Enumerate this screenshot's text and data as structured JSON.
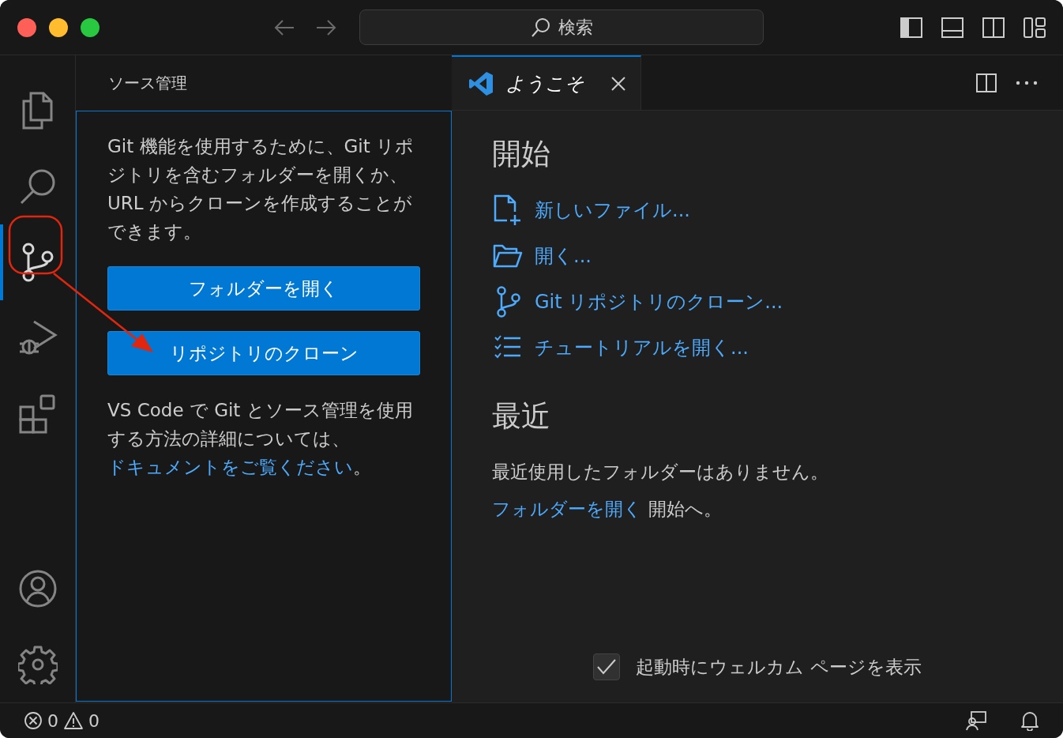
{
  "title_bar": {
    "search_label": "検索"
  },
  "activity_bar": {
    "items": [
      {
        "kind": "files",
        "selected": false
      },
      {
        "kind": "search",
        "selected": false
      },
      {
        "kind": "source-control",
        "selected": true
      },
      {
        "kind": "run-debug",
        "selected": false
      },
      {
        "kind": "extensions",
        "selected": false
      }
    ],
    "bottom_items": [
      {
        "kind": "account"
      },
      {
        "kind": "settings"
      }
    ]
  },
  "sidebar": {
    "title": "ソース管理",
    "intro": "Git 機能を使用するために、Git リポジトリを含むフォルダーを開くか、URL からクローンを作成することができます。",
    "buttons": [
      "フォルダーを開く",
      "リポジトリのクローン"
    ],
    "docs_text": "VS Code で Git とソース管理を使用する方法の詳細については、",
    "docs_link": "ドキュメントをご覧ください",
    "docs_end": "。"
  },
  "editor": {
    "tabs": [
      {
        "label": "ようこそ",
        "selected": true
      }
    ],
    "start": {
      "heading": "開始",
      "items": [
        {
          "kind": "new-file",
          "label": "新しいファイル..."
        },
        {
          "kind": "open",
          "label": "開く..."
        },
        {
          "kind": "clone",
          "label": "Git リポジトリのクローン..."
        },
        {
          "kind": "tutorial",
          "label": "チュートリアルを開く..."
        }
      ]
    },
    "recent": {
      "heading": "最近",
      "empty": "最近使用したフォルダーはありません。",
      "link": "フォルダーを開く",
      "after": "開始へ。"
    },
    "show_on_startup": {
      "label": "起動時にウェルカム ページを表示",
      "checked": true
    }
  },
  "status_bar": {
    "errors": "0",
    "warnings": "0"
  }
}
